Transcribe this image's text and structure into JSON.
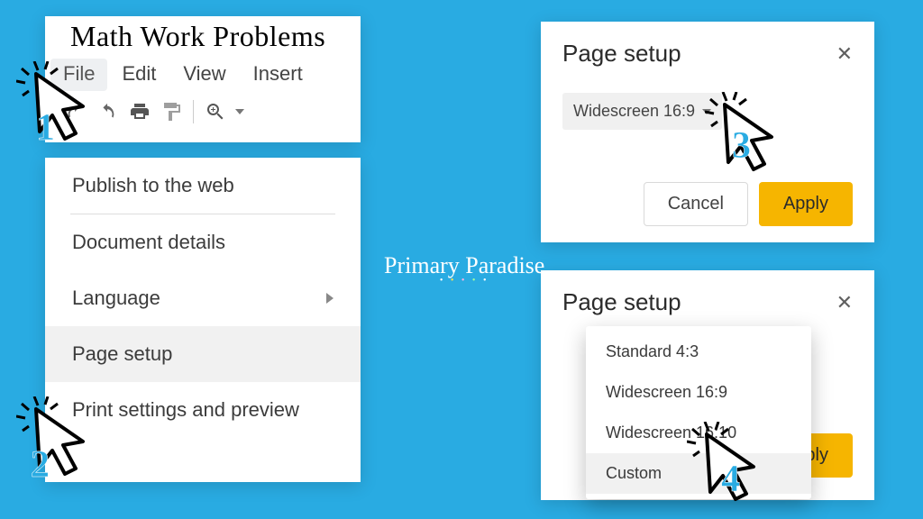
{
  "doc_title": "Math Work Problems",
  "menubar": {
    "file": "File",
    "edit": "Edit",
    "view": "View",
    "insert": "Insert"
  },
  "file_menu": {
    "publish": "Publish to the web",
    "details": "Document details",
    "language": "Language",
    "page_setup": "Page setup",
    "print_preview": "Print settings and preview"
  },
  "dialog": {
    "title": "Page setup",
    "selected_ratio": "Widescreen 16:9",
    "cancel": "Cancel",
    "apply": "Apply"
  },
  "ratios": {
    "standard": "Standard 4:3",
    "wide169": "Widescreen 16:9",
    "wide1610": "Widescreen 16:10",
    "custom": "Custom"
  },
  "steps": {
    "s1": "1",
    "s2": "2",
    "s3": "3",
    "s4": "4"
  },
  "brand": "Primary Paradise"
}
